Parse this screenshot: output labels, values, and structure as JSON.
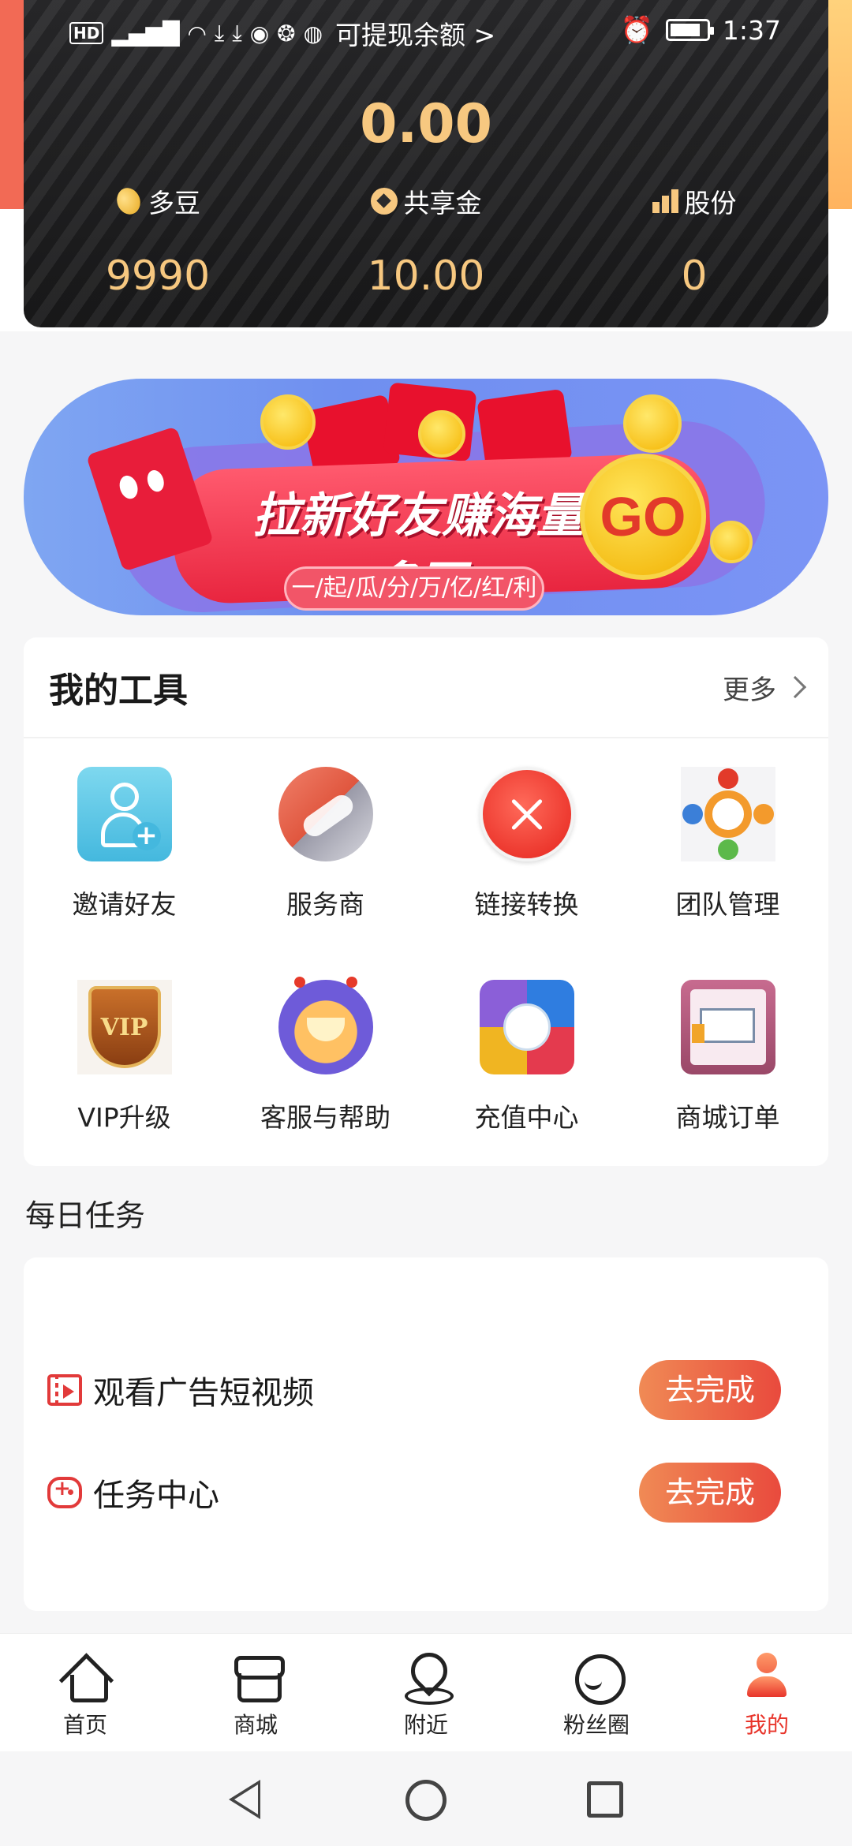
{
  "status_bar": {
    "title": "可提现余额 >",
    "time": "1:37",
    "battery_level": 0.85
  },
  "balance": {
    "amount": "0.00",
    "stats": [
      {
        "label": "多豆",
        "value": "9990",
        "icon": "coin-icon"
      },
      {
        "label": "共享金",
        "value": "10.00",
        "icon": "share-gold-icon"
      },
      {
        "label": "股份",
        "value": "0",
        "icon": "bar-chart-icon"
      }
    ]
  },
  "banner": {
    "title": "拉新好友赚海量多豆",
    "subtitle": "一/起/瓜/分/万/亿/红/利",
    "go": "GO"
  },
  "tools": {
    "title": "我的工具",
    "more": "更多",
    "items": [
      {
        "label": "邀请好友",
        "icon": "invite-friend-icon"
      },
      {
        "label": "服务商",
        "icon": "handshake-icon"
      },
      {
        "label": "链接转换",
        "icon": "link-convert-icon"
      },
      {
        "label": "团队管理",
        "icon": "team-icon"
      },
      {
        "label": "VIP升级",
        "icon": "vip-badge-icon"
      },
      {
        "label": "客服与帮助",
        "icon": "customer-service-icon"
      },
      {
        "label": "充值中心",
        "icon": "recharge-icon"
      },
      {
        "label": "商城订单",
        "icon": "truck-icon"
      }
    ]
  },
  "daily_tasks": {
    "title": "每日任务",
    "items": [
      {
        "label": "观看广告短视频",
        "button": "去完成",
        "icon": "video-icon"
      },
      {
        "label": "任务中心",
        "button": "去完成",
        "icon": "gamepad-icon"
      }
    ]
  },
  "bottom_nav": {
    "items": [
      {
        "label": "首页",
        "icon": "home-icon"
      },
      {
        "label": "商城",
        "icon": "shop-icon"
      },
      {
        "label": "附近",
        "icon": "location-icon"
      },
      {
        "label": "粉丝圈",
        "icon": "chat-icon"
      },
      {
        "label": "我的",
        "icon": "profile-icon",
        "active": true
      }
    ]
  },
  "colors": {
    "accent_gold": "#f7c880",
    "accent_red": "#e8352b",
    "button_gradient_start": "#f08a55",
    "button_gradient_end": "#e94a3d"
  }
}
